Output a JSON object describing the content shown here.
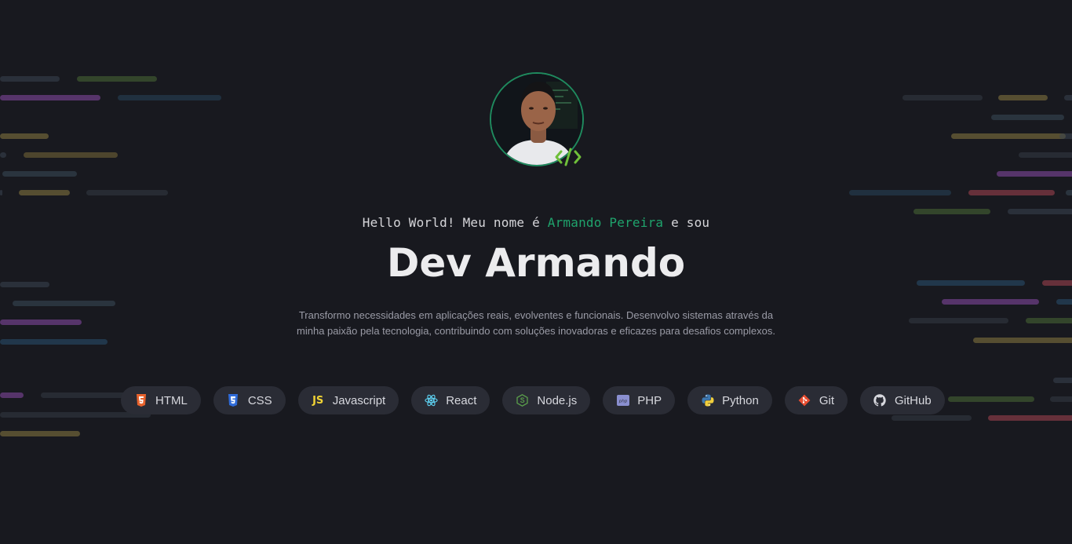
{
  "hero": {
    "greeting_prefix": "Hello World! Meu nome é ",
    "greeting_name": "Armando Pereira",
    "greeting_suffix": " e sou",
    "title": "Dev Armando",
    "description_line1": "Transformo necessidades em aplicações reais, evolventes e funcionais. Desenvolvo sistemas através da",
    "description_line2": "minha paixão pela tecnologia, contribuindo com soluções inovadoras e eficazes para desafios complexos."
  },
  "skills": [
    {
      "label": "HTML",
      "icon": "html5-icon",
      "color": "#e8622c"
    },
    {
      "label": "CSS",
      "icon": "css3-icon",
      "color": "#2f6bd8"
    },
    {
      "label": "Javascript",
      "icon": "javascript-icon",
      "icon_text": "JS",
      "color": "#f0d335"
    },
    {
      "label": "React",
      "icon": "react-icon",
      "color": "#5ed3f3"
    },
    {
      "label": "Node.js",
      "icon": "nodejs-icon",
      "color": "#5a9e4b"
    },
    {
      "label": "PHP",
      "icon": "php-icon",
      "color": "#8a8fd0"
    },
    {
      "label": "Python",
      "icon": "python-icon",
      "color": "#3d78b0"
    },
    {
      "label": "Git",
      "icon": "git-icon",
      "color": "#e84e31"
    },
    {
      "label": "GitHub",
      "icon": "github-icon",
      "color": "#d7d8de"
    }
  ],
  "colors": {
    "background": "#18191f",
    "accent": "#1fa36c",
    "chip_background": "#2a2c35"
  }
}
